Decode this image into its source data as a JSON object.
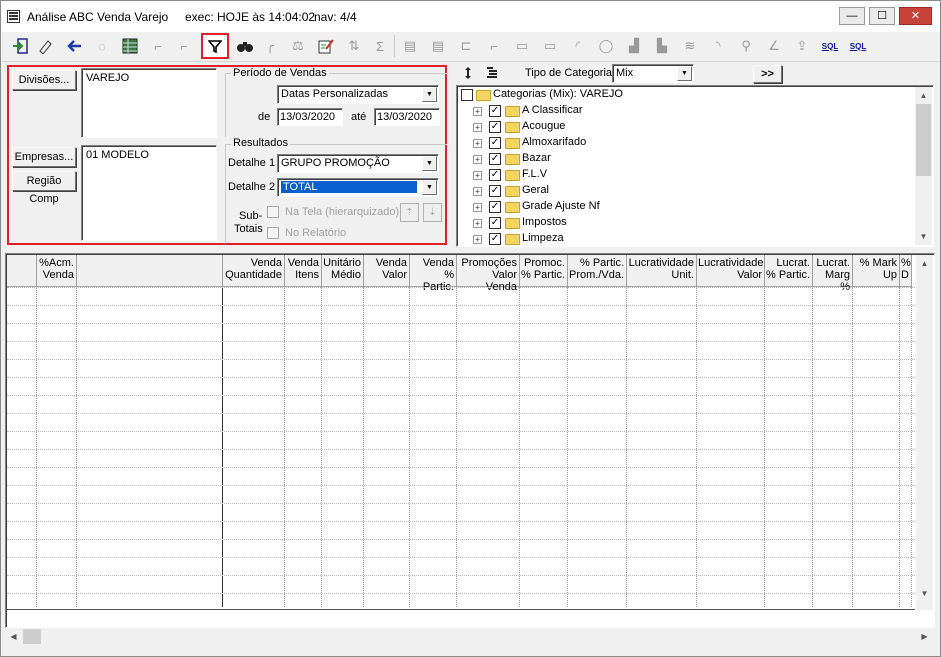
{
  "window": {
    "title": "Análise ABC Venda Varejo",
    "exec": "exec: HOJE às 14:04:02",
    "nav": "nav: 4/4",
    "minimize": "—",
    "maximize": "☐",
    "close": "✕"
  },
  "toolbar": {
    "filter_icon": "filter-icon",
    "sql1": "SQL",
    "sql2": "SQL"
  },
  "filters": {
    "divisoes_button": "Divisões...",
    "divisoes_value": "VAREJO",
    "empresas_button": "Empresas...",
    "regiao_button": "Região Comp",
    "empresas_value": "01 MODELO",
    "periodo_label": "Período de Vendas",
    "periodo_select": "Datas Personalizadas",
    "de_label": "de",
    "date_from": "13/03/2020",
    "ate_label": "até",
    "date_to": "13/03/2020",
    "resultados_label": "Resultados",
    "detalhe1_label": "Detalhe 1",
    "detalhe1_value": "GRUPO PROMOÇÃO",
    "detalhe2_label": "Detalhe 2",
    "detalhe2_value": "TOTAL",
    "subtotais_label1": "Sub-",
    "subtotais_label2": "Totais",
    "na_tela_label": "Na Tela (hierarquizado)",
    "no_relatorio_label": "No Relatório"
  },
  "tree": {
    "tipo_label": "Tipo de Categoria",
    "tipo_value": "Mix",
    "expand_button": ">>",
    "root": "Categorias (Mix): VAREJO",
    "items": [
      "A Classificar",
      "Acougue",
      "Almoxarifado",
      "Bazar",
      "F.L.V",
      "Geral",
      "Grade Ajuste Nf",
      "Impostos",
      "Limpeza"
    ]
  },
  "grid": {
    "columns": [
      {
        "l1": "%Acm.",
        "l2": "Venda"
      },
      {
        "l1": "",
        "l2": ""
      },
      {
        "l1": "Venda",
        "l2": "Quantidade"
      },
      {
        "l1": "Venda",
        "l2": "Itens"
      },
      {
        "l1": "Unitário",
        "l2": "Médio"
      },
      {
        "l1": "Venda",
        "l2": "Valor"
      },
      {
        "l1": "Venda",
        "l2": "% Partic."
      },
      {
        "l1": "Promoções",
        "l2": "Valor Venda"
      },
      {
        "l1": "Promoc.",
        "l2": "% Partic."
      },
      {
        "l1": "% Partic.",
        "l2": "Prom./Vda."
      },
      {
        "l1": "Lucratividade",
        "l2": "Unit."
      },
      {
        "l1": "Lucratividade",
        "l2": "Valor"
      },
      {
        "l1": "Lucrat.",
        "l2": "% Partic."
      },
      {
        "l1": "Lucrat.",
        "l2": "Marg %"
      },
      {
        "l1": "% Mark",
        "l2": "Up"
      },
      {
        "l1": "%",
        "l2": "D"
      }
    ]
  }
}
